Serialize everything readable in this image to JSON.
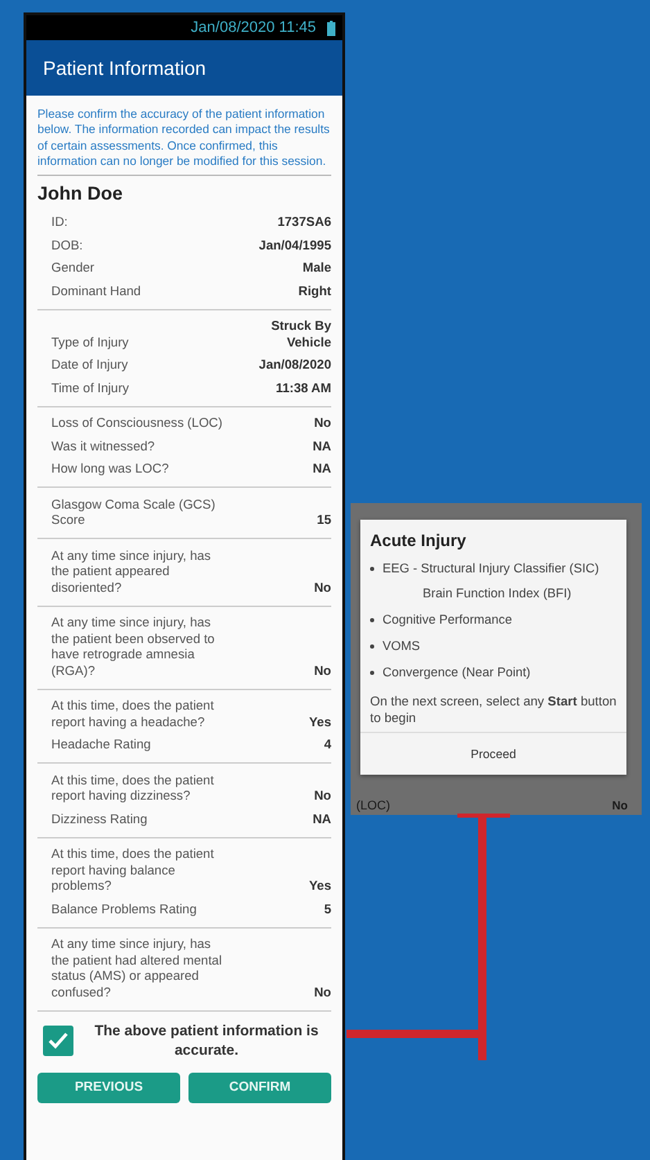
{
  "status_bar": {
    "datetime": "Jan/08/2020 11:45"
  },
  "header": {
    "title": "Patient Information"
  },
  "intro": "Please confirm the accuracy of the patient information below. The information recorded can impact the results of certain assessments. Once confirmed, this information can no longer be modified for this session.",
  "patient_name": "John Doe",
  "groups": [
    {
      "rows": [
        {
          "label": "ID:",
          "value": "1737SA6"
        },
        {
          "label": "DOB:",
          "value": "Jan/04/1995"
        },
        {
          "label": "Gender",
          "value": "Male"
        },
        {
          "label": "Dominant Hand",
          "value": "Right"
        }
      ]
    },
    {
      "rows": [
        {
          "label": "Type of Injury",
          "value": "Struck By Vehicle"
        },
        {
          "label": "Date of Injury",
          "value": "Jan/08/2020"
        },
        {
          "label": "Time of Injury",
          "value": "11:38 AM"
        }
      ]
    },
    {
      "rows": [
        {
          "label": "Loss of Consciousness (LOC)",
          "value": "No"
        },
        {
          "label": "Was it witnessed?",
          "value": "NA"
        },
        {
          "label": "How long was LOC?",
          "value": "NA"
        }
      ]
    },
    {
      "rows": [
        {
          "label": "Glasgow Coma Scale (GCS) Score",
          "value": "15"
        }
      ]
    },
    {
      "rows": [
        {
          "label": "At any time since injury, has the patient appeared disoriented?",
          "value": "No"
        }
      ]
    },
    {
      "rows": [
        {
          "label": "At any time since injury, has the patient been observed to have retrograde amnesia (RGA)?",
          "value": "No"
        }
      ]
    },
    {
      "rows": [
        {
          "label": "At this time, does the patient report having a headache?",
          "value": "Yes"
        },
        {
          "label": "Headache Rating",
          "value": "4"
        }
      ]
    },
    {
      "rows": [
        {
          "label": "At this time, does the patient report having dizziness?",
          "value": "No"
        },
        {
          "label": "Dizziness Rating",
          "value": "NA"
        }
      ]
    },
    {
      "rows": [
        {
          "label": "At this time, does the patient report having balance problems?",
          "value": "Yes"
        },
        {
          "label": "Balance Problems Rating",
          "value": "5"
        }
      ]
    },
    {
      "rows": [
        {
          "label": "At any time since injury, has the patient had altered mental status (AMS) or appeared confused?",
          "value": "No"
        }
      ]
    }
  ],
  "confirmation": {
    "label": "The above patient information is accurate.",
    "checked": true
  },
  "buttons": [
    "PREVIOUS",
    "CONFIRM"
  ],
  "dialog": {
    "title": "Acute Injury",
    "items": [
      {
        "lines": [
          "EEG - Structural Injury Classifier (SIC)",
          "Brain Function Index (BFI)"
        ]
      },
      {
        "lines": [
          "Cognitive Performance"
        ]
      },
      {
        "lines": [
          "VOMS"
        ]
      },
      {
        "lines": [
          "Convergence (Near Point)"
        ]
      }
    ],
    "note": "On the next screen, select any **Start** button to begin",
    "button": "Proceed"
  },
  "background_screen": {
    "label": "(LOC)",
    "value": "No"
  }
}
